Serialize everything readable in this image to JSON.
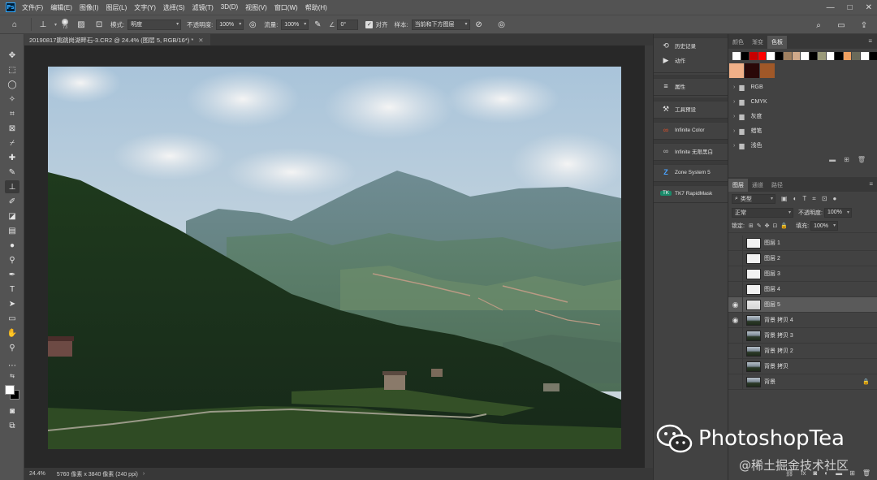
{
  "menu": {
    "logo": "Ps",
    "items": [
      "文件(F)",
      "编辑(E)",
      "图像(I)",
      "图层(L)",
      "文字(Y)",
      "选择(S)",
      "滤镜(T)",
      "3D(D)",
      "视图(V)",
      "窗口(W)",
      "帮助(H)"
    ],
    "window_controls": [
      "—",
      "□",
      "✕"
    ]
  },
  "options": {
    "brush_size": "73",
    "mode_label": "模式:",
    "mode_value": "明度",
    "opacity_label": "不透明度:",
    "opacity_value": "100%",
    "flow_label": "流量:",
    "flow_value": "100%",
    "angle_value": "0°",
    "aligned_label": "对齐",
    "sample_label": "样本:",
    "sample_value": "当前和下方图层"
  },
  "document": {
    "tab_title": "20190817跳跳岗湖畔石-3.CR2 @ 24.4% (图层 5, RGB/16*) *",
    "zoom": "24.4%",
    "info": "5760 像素 x 3840 像素 (240 ppi)"
  },
  "collapsed_panels": [
    {
      "icon": "history-icon",
      "glyph": "⟲",
      "label": "历史记录"
    },
    {
      "icon": "play-icon",
      "glyph": "▶",
      "label": "动作"
    },
    {
      "icon": "properties-icon",
      "glyph": "≡",
      "label": "属性"
    },
    {
      "icon": "tool-presets-icon",
      "glyph": "⚒",
      "label": "工具预设"
    },
    {
      "icon": "infinite-color-icon",
      "glyph": "∞",
      "label": "Infinite Color"
    },
    {
      "icon": "infinite-bw-icon",
      "glyph": "∞",
      "label": "Infinite 无限黑白"
    },
    {
      "icon": "zone-system-icon",
      "glyph": "Z",
      "label": "Zone System 5"
    },
    {
      "icon": "tk7-icon",
      "glyph": "TK",
      "label": "TK7 RapidMask"
    }
  ],
  "swatches_panel": {
    "tabs": [
      "颜色",
      "渐变",
      "色板"
    ],
    "active_tab": "色板",
    "row_colors": [
      "#ffffff",
      "#000000",
      "#c80000",
      "#ff0000",
      "#ffffff",
      "#000000",
      "#a08060",
      "#cfa98a",
      "#ffffff",
      "#000000",
      "#9a9a7a",
      "#ffffff",
      "#000000",
      "#f0a060",
      "#6a6a5a",
      "#ffffff",
      "#000000"
    ],
    "recent_colors": [
      "#f0b088",
      "#2a0808",
      "#a05828"
    ],
    "folders": [
      "RGB",
      "CMYK",
      "灰度",
      "蜡笔",
      "浅色"
    ]
  },
  "layers_panel": {
    "tabs": [
      "图层",
      "通道",
      "路径"
    ],
    "active_tab": "图层",
    "filter_value": "类型",
    "blend_mode": "正常",
    "opacity_label": "不透明度:",
    "opacity_value": "100%",
    "lock_label": "锁定:",
    "fill_label": "填充:",
    "fill_value": "100%",
    "layers": [
      {
        "name": "图层 1",
        "visible": false,
        "thumb": "white",
        "selected": false,
        "locked": false
      },
      {
        "name": "图层 2",
        "visible": false,
        "thumb": "white",
        "selected": false,
        "locked": false
      },
      {
        "name": "图层 3",
        "visible": false,
        "thumb": "white",
        "selected": false,
        "locked": false
      },
      {
        "name": "图层 4",
        "visible": false,
        "thumb": "white",
        "selected": false,
        "locked": false
      },
      {
        "name": "图层 5",
        "visible": true,
        "thumb": "pixel",
        "selected": true,
        "locked": false
      },
      {
        "name": "背景 拷贝 4",
        "visible": true,
        "thumb": "photo",
        "selected": false,
        "locked": false
      },
      {
        "name": "背景 拷贝 3",
        "visible": false,
        "thumb": "photo",
        "selected": false,
        "locked": false
      },
      {
        "name": "背景 拷贝 2",
        "visible": false,
        "thumb": "photo",
        "selected": false,
        "locked": false
      },
      {
        "name": "背景 拷贝",
        "visible": false,
        "thumb": "photo",
        "selected": false,
        "locked": false
      },
      {
        "name": "背景",
        "visible": false,
        "thumb": "photo",
        "selected": false,
        "locked": true
      }
    ]
  },
  "watermark": {
    "brand": "PhotoshopTea",
    "site": "@稀土掘金技术社区"
  }
}
